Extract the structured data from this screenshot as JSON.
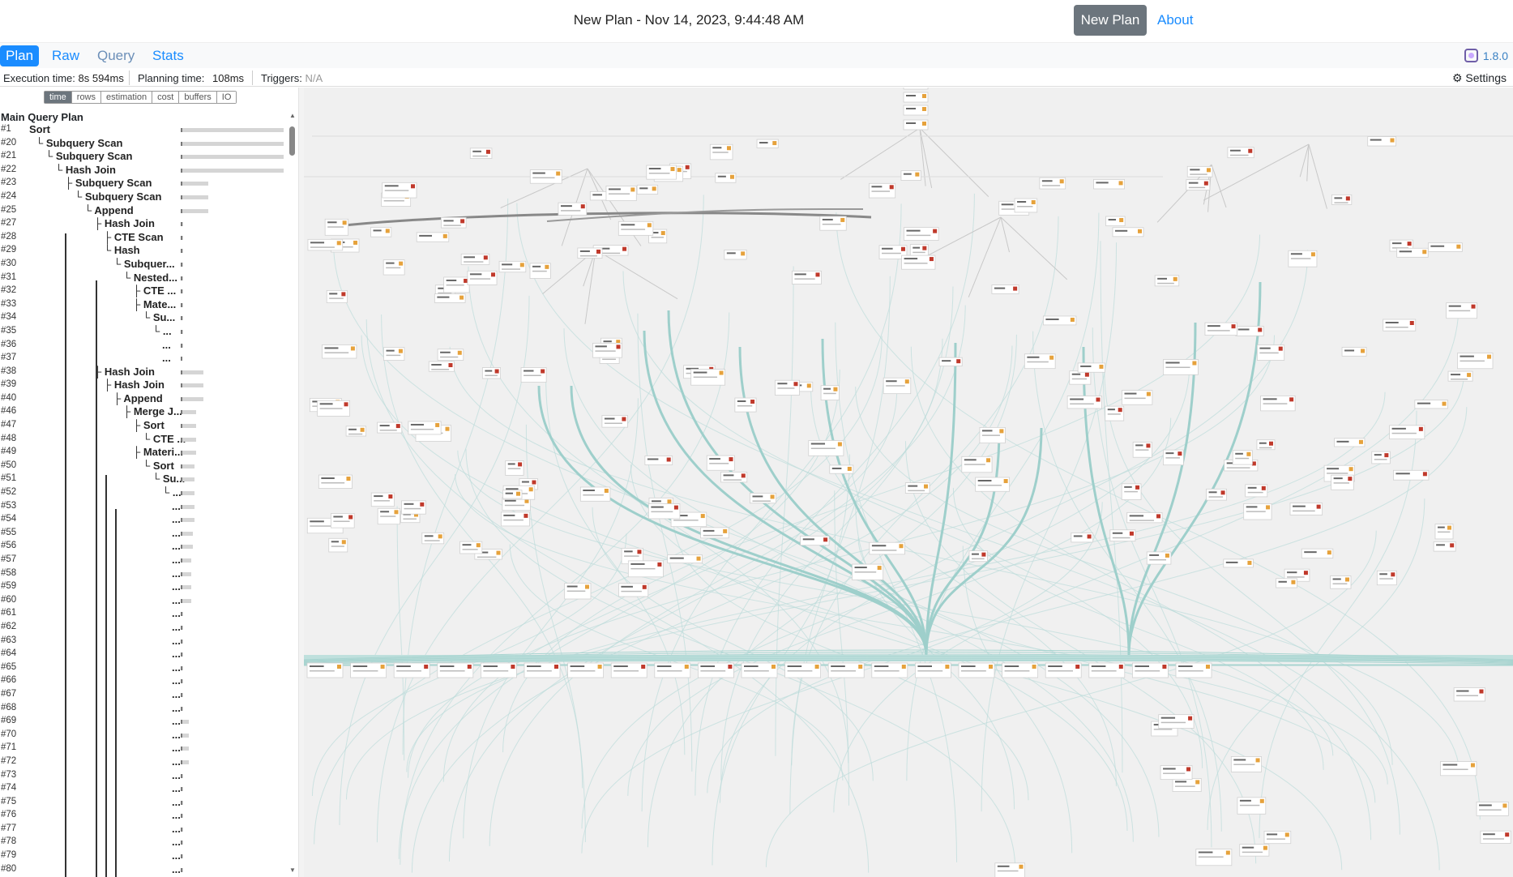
{
  "header": {
    "title": "New Plan - Nov 14, 2023, 9:44:48 AM",
    "new_plan_label": "New Plan",
    "about_label": "About"
  },
  "tabs": [
    {
      "label": "Plan",
      "active": true
    },
    {
      "label": "Raw",
      "active": false
    },
    {
      "label": "Query",
      "active": false
    },
    {
      "label": "Stats",
      "active": false
    }
  ],
  "version": "1.8.0",
  "stats": {
    "execution_label": "Execution time:",
    "execution_value": "8s 594ms",
    "planning_label": "Planning time:",
    "planning_value": "108ms",
    "triggers_label": "Triggers:",
    "triggers_value": "N/A",
    "settings_label": "Settings"
  },
  "metrics": [
    "time",
    "rows",
    "estimation",
    "cost",
    "buffers",
    "IO"
  ],
  "active_metric": "time",
  "sidebar": {
    "heading": "Main Query Plan",
    "rows": [
      {
        "num": "#1",
        "label": "Sort",
        "depth": 0,
        "share": 1.0
      },
      {
        "num": "#20",
        "label": "└ Subquery Scan",
        "depth": 1,
        "share": 1.0
      },
      {
        "num": "#21",
        "label": "└ Subquery Scan",
        "depth": 2,
        "share": 1.0
      },
      {
        "num": "#22",
        "label": "└ Hash Join",
        "depth": 3,
        "share": 1.0
      },
      {
        "num": "#23",
        "label": "├ Subquery Scan",
        "depth": 4,
        "share": 0.27
      },
      {
        "num": "#24",
        "label": "└ Subquery Scan",
        "depth": 5,
        "share": 0.27
      },
      {
        "num": "#25",
        "label": "└ Append",
        "depth": 6,
        "share": 0.27
      },
      {
        "num": "#27",
        "label": "├ Hash Join",
        "depth": 7,
        "share": 0.02
      },
      {
        "num": "#28",
        "label": "├ CTE Scan",
        "depth": 8,
        "share": 0.02
      },
      {
        "num": "#29",
        "label": "└ Hash",
        "depth": 8,
        "share": 0.02
      },
      {
        "num": "#30",
        "label": "└ Subquer...",
        "depth": 9,
        "share": 0.02
      },
      {
        "num": "#31",
        "label": "└ Nested...",
        "depth": 10,
        "share": 0.02
      },
      {
        "num": "#32",
        "label": "├ CTE ...",
        "depth": 11,
        "share": 0.02
      },
      {
        "num": "#33",
        "label": "├ Mate...",
        "depth": 11,
        "share": 0.02
      },
      {
        "num": "#34",
        "label": "└ Su...",
        "depth": 12,
        "share": 0.02
      },
      {
        "num": "#35",
        "label": "└ ...",
        "depth": 13,
        "share": 0.02
      },
      {
        "num": "#36",
        "label": "...",
        "depth": 14,
        "share": 0.02
      },
      {
        "num": "#37",
        "label": "...",
        "depth": 14,
        "share": 0.0
      },
      {
        "num": "#38",
        "label": "├ Hash Join",
        "depth": 7,
        "share": 0.22
      },
      {
        "num": "#39",
        "label": "├ Hash Join",
        "depth": 8,
        "share": 0.22
      },
      {
        "num": "#40",
        "label": "├ Append",
        "depth": 9,
        "share": 0.22
      },
      {
        "num": "#46",
        "label": "├ Merge J...",
        "depth": 10,
        "share": 0.15
      },
      {
        "num": "#47",
        "label": "├ Sort",
        "depth": 11,
        "share": 0.15
      },
      {
        "num": "#48",
        "label": "└ CTE ...",
        "depth": 12,
        "share": 0.15
      },
      {
        "num": "#49",
        "label": "├ Materi...",
        "depth": 11,
        "share": 0.15
      },
      {
        "num": "#50",
        "label": "└ Sort",
        "depth": 12,
        "share": 0.13
      },
      {
        "num": "#51",
        "label": "└ Su...",
        "depth": 13,
        "share": 0.13
      },
      {
        "num": "#52",
        "label": "└ ...",
        "depth": 14,
        "share": 0.13
      },
      {
        "num": "#53",
        "label": "...",
        "depth": 15,
        "share": 0.13
      },
      {
        "num": "#54",
        "label": "...",
        "depth": 15,
        "share": 0.13
      },
      {
        "num": "#55",
        "label": "...",
        "depth": 15,
        "share": 0.12
      },
      {
        "num": "#56",
        "label": "...",
        "depth": 15,
        "share": 0.12
      },
      {
        "num": "#57",
        "label": "...",
        "depth": 15,
        "share": 0.1
      },
      {
        "num": "#58",
        "label": "...",
        "depth": 15,
        "share": 0.1
      },
      {
        "num": "#59",
        "label": "...",
        "depth": 15,
        "share": 0.1
      },
      {
        "num": "#60",
        "label": "...",
        "depth": 15,
        "share": 0.1
      },
      {
        "num": "#61",
        "label": "...",
        "depth": 15,
        "share": 0.02
      },
      {
        "num": "#62",
        "label": "...",
        "depth": 15,
        "share": 0.02
      },
      {
        "num": "#63",
        "label": "...",
        "depth": 15,
        "share": 0.02
      },
      {
        "num": "#64",
        "label": "...",
        "depth": 15,
        "share": 0.02
      },
      {
        "num": "#65",
        "label": "...",
        "depth": 15,
        "share": 0.02
      },
      {
        "num": "#66",
        "label": "...",
        "depth": 15,
        "share": 0.02
      },
      {
        "num": "#67",
        "label": "...",
        "depth": 15,
        "share": 0.02
      },
      {
        "num": "#68",
        "label": "...",
        "depth": 15,
        "share": 0.02
      },
      {
        "num": "#69",
        "label": "...",
        "depth": 15,
        "share": 0.08
      },
      {
        "num": "#70",
        "label": "...",
        "depth": 15,
        "share": 0.08
      },
      {
        "num": "#71",
        "label": "...",
        "depth": 15,
        "share": 0.08
      },
      {
        "num": "#72",
        "label": "...",
        "depth": 15,
        "share": 0.08
      },
      {
        "num": "#73",
        "label": "...",
        "depth": 15,
        "share": 0.02
      },
      {
        "num": "#74",
        "label": "...",
        "depth": 15,
        "share": 0.02
      },
      {
        "num": "#75",
        "label": "...",
        "depth": 15,
        "share": 0.02
      },
      {
        "num": "#76",
        "label": "...",
        "depth": 15,
        "share": 0.02
      },
      {
        "num": "#77",
        "label": "...",
        "depth": 15,
        "share": 0.02
      },
      {
        "num": "#78",
        "label": "...",
        "depth": 15,
        "share": 0.02
      },
      {
        "num": "#79",
        "label": "...",
        "depth": 15,
        "share": 0.02
      },
      {
        "num": "#80",
        "label": "...",
        "depth": 15,
        "share": 0.02
      }
    ]
  },
  "colors": {
    "accent": "#1a8cff",
    "edge": "#9ecfcb",
    "button": "#6c757d"
  }
}
